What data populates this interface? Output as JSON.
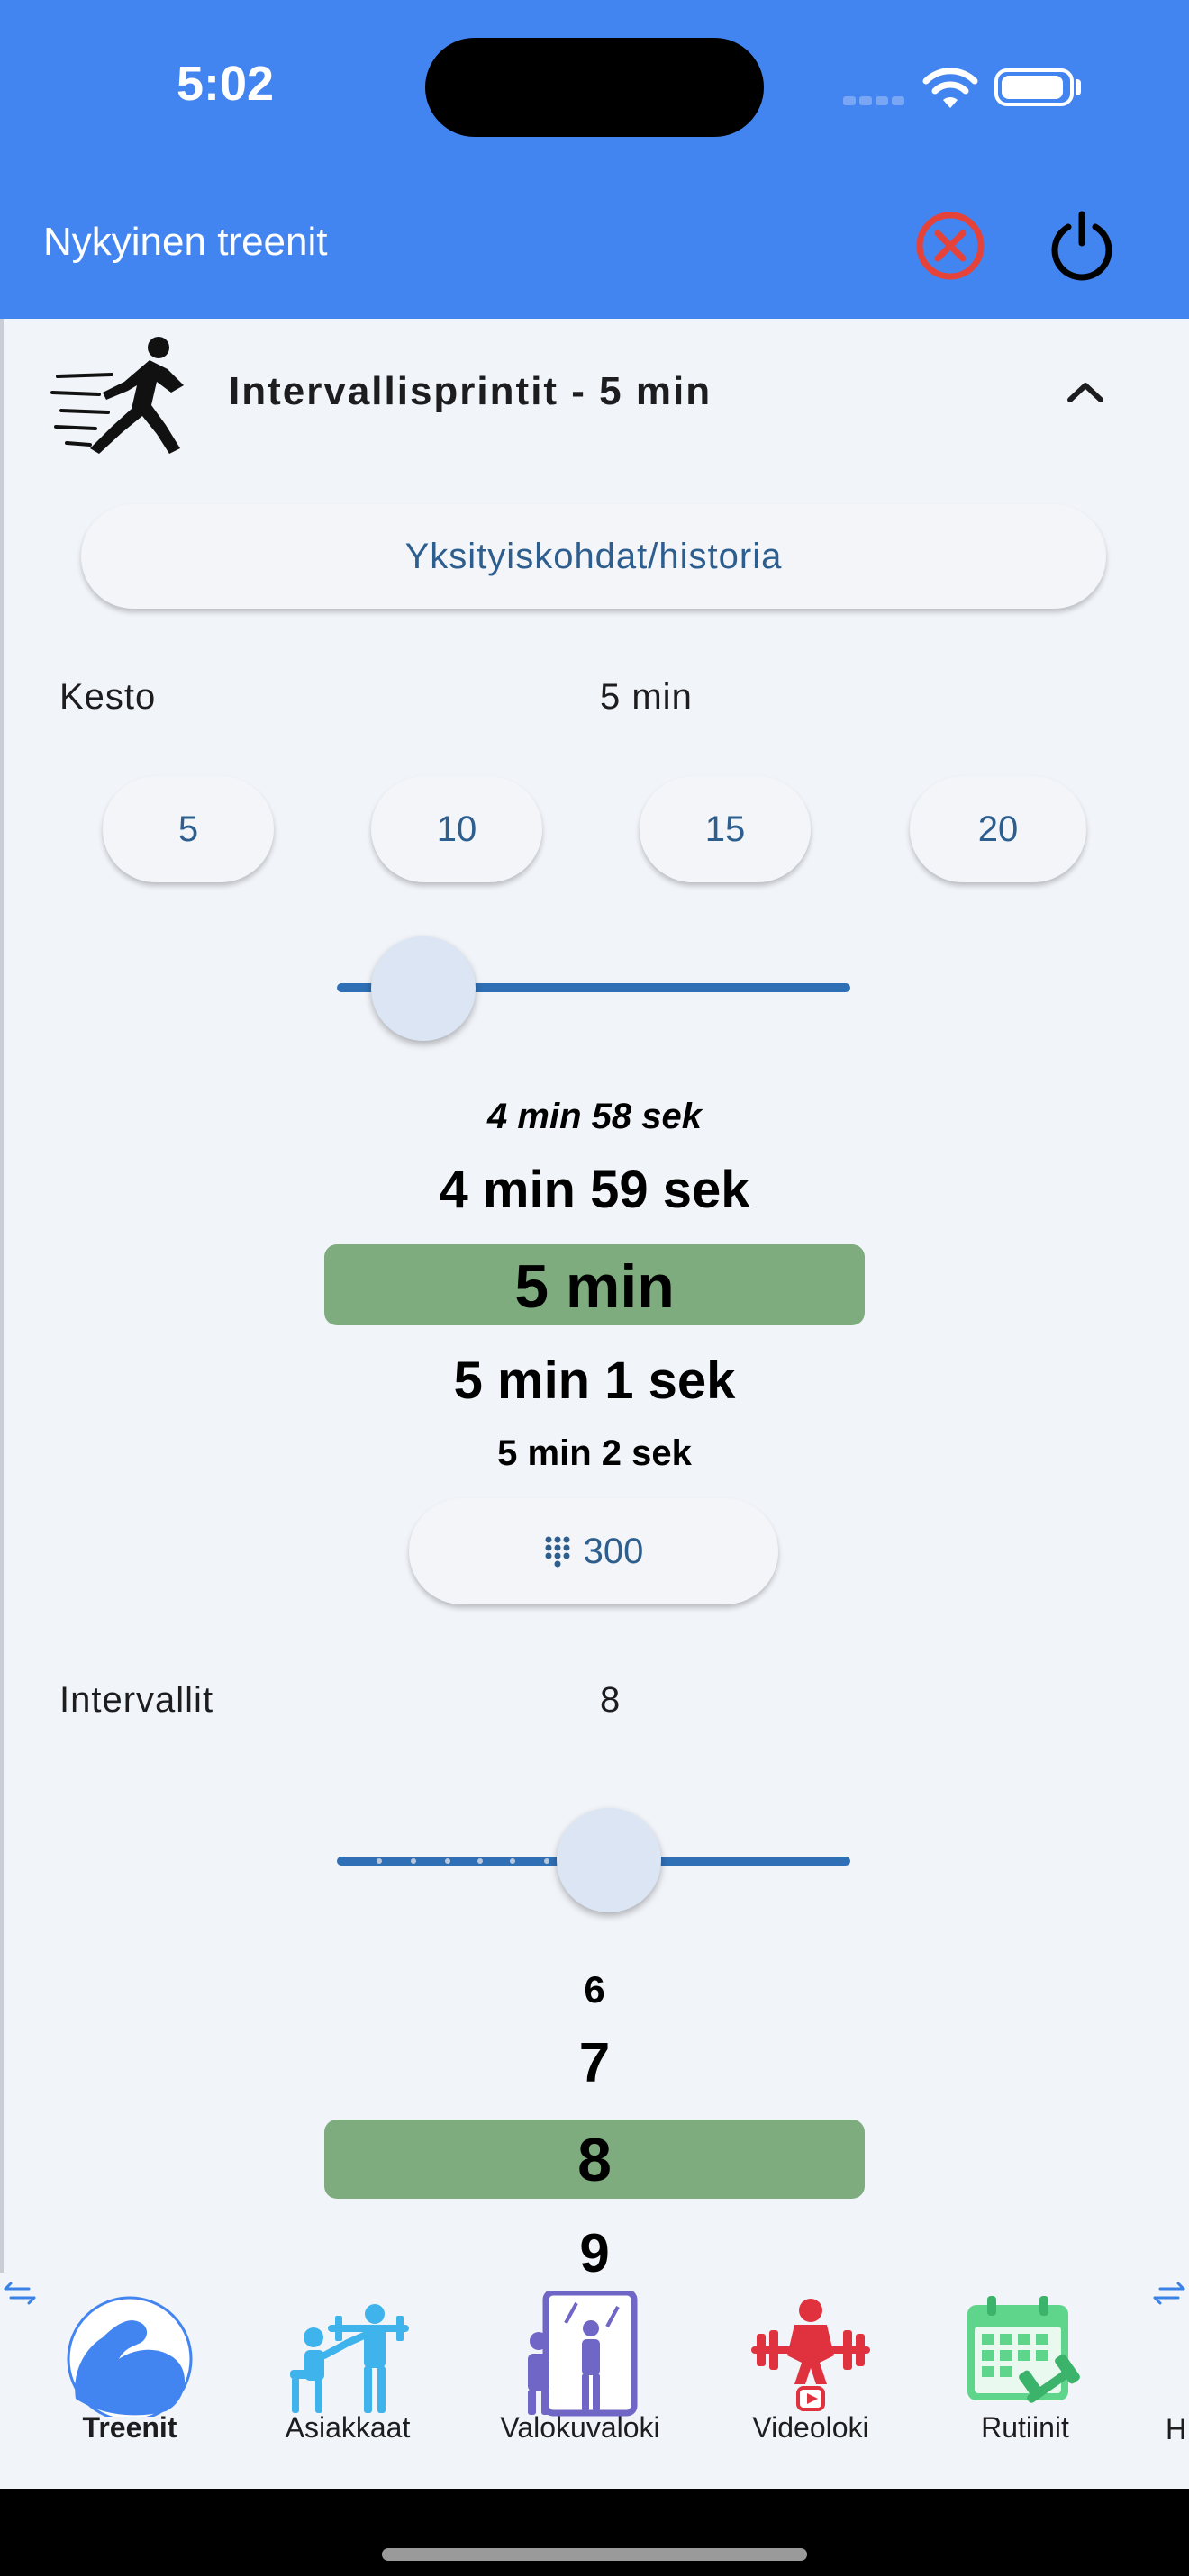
{
  "status_bar": {
    "time": "5:02"
  },
  "header": {
    "title": "Nykyinen treenit",
    "stop_icon": "close-circle-icon",
    "power_icon": "power-icon"
  },
  "workout": {
    "title": "Intervallisprintit - 5 min",
    "details_button": "Yksityiskohdat/historia"
  },
  "duration": {
    "label": "Kesto",
    "value": "5 min",
    "presets": [
      "5",
      "10",
      "15",
      "20"
    ],
    "slider_fraction": 0.13,
    "picker_options": [
      "4 min 58 sek",
      "4 min 59 sek",
      "5 min",
      "5 min 1 sek",
      "5 min 2 sek"
    ],
    "selected_index": 2,
    "seconds_button": "300"
  },
  "intervals": {
    "label": "Intervallit",
    "value": "8",
    "slider_fraction": 0.54,
    "picker_options": [
      "6",
      "7",
      "8",
      "9"
    ],
    "selected_index": 2
  },
  "bottom_nav": {
    "items": [
      {
        "label": "Treenit",
        "icon": "flexed-arm-icon",
        "active": true
      },
      {
        "label": "Asiakkaat",
        "icon": "trainer-client-icon",
        "active": false
      },
      {
        "label": "Valokuvaloki",
        "icon": "mirror-selfie-icon",
        "active": false
      },
      {
        "label": "Videoloki",
        "icon": "weightlifter-video-icon",
        "active": false
      },
      {
        "label": "Rutiinit",
        "icon": "calendar-dumbbell-icon",
        "active": false
      }
    ],
    "cut_off_label": "H"
  },
  "colors": {
    "header_blue": "#4385f0",
    "accent_blue": "#2f6fb5",
    "picker_selected": "#7fac7f",
    "stop_red": "#e5423a"
  }
}
